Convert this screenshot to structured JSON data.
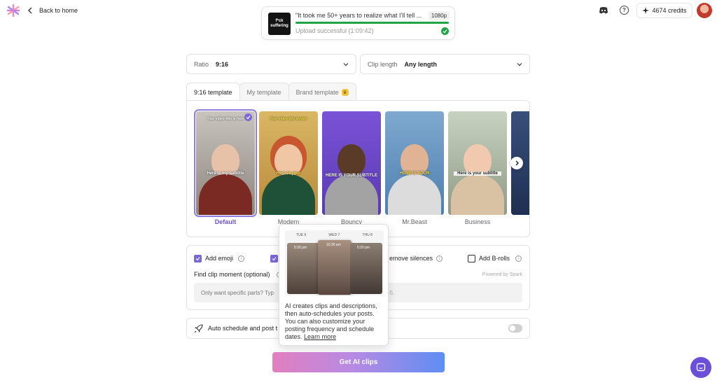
{
  "header": {
    "back_label": "Back to home",
    "credits": "4674 credits"
  },
  "upload": {
    "thumb_text": "f*ck suffering",
    "title": "\"It took me 50+ years to realize what I'll tell ...",
    "resolution": "1080p",
    "status": "Upload successful (1:09:42)",
    "progress": 1.0
  },
  "settings": {
    "ratio_label": "Ratio",
    "ratio_value": "9:16",
    "clip_length_label": "Clip length",
    "clip_length_value": "Any length"
  },
  "tabs": [
    "9:16 template",
    "My template",
    "Brand template"
  ],
  "templates": [
    {
      "name": "Default",
      "top_text": "Your video title is here",
      "subtitle": "Here is my subtitle",
      "selected": true
    },
    {
      "name": "Modern",
      "top_text": "Your video title is here",
      "subtitle": "Here is your",
      "selected": false
    },
    {
      "name": "Bouncy",
      "top_text": "",
      "subtitle": "HERE IS YOUR SUBTITLE",
      "selected": false
    },
    {
      "name": "Mr.Beast",
      "top_text": "",
      "subtitle": "HERE IS YOUR",
      "selected": false
    },
    {
      "name": "Business",
      "top_text": "",
      "subtitle": "Here is your subtitle",
      "selected": false
    }
  ],
  "options": {
    "add_emoji": "Add emoji",
    "remove_silences": "emove silences",
    "add_brolls": "Add B-rolls",
    "powered_by": "Powered by Spark",
    "find_label": "Find clip moment (optional)",
    "find_placeholder": "Only want specific parts? Typ",
    "find_suffix": "-5."
  },
  "schedule": {
    "label": "Auto schedule and post t"
  },
  "popover": {
    "days": [
      "TUE 6",
      "WED 7",
      "THU 8"
    ],
    "times": [
      "5:30 pm",
      "10:30 am",
      "5:20 pm"
    ],
    "text": "AI creates clips and descriptions, then auto-schedules your posts. You can also customize your posting frequency and schedule dates.",
    "link": "Learn more"
  },
  "cta": {
    "label": "Get AI clips"
  },
  "colors": {
    "accent": "#7b68d8",
    "success": "#22a34a"
  }
}
